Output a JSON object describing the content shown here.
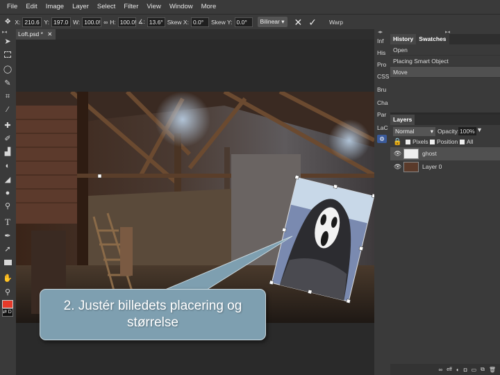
{
  "menu": [
    "File",
    "Edit",
    "Image",
    "Layer",
    "Select",
    "Filter",
    "View",
    "Window",
    "More"
  ],
  "options": {
    "x_label": "X:",
    "x_value": "210.6",
    "y_label": "Y:",
    "y_value": "197.0",
    "w_label": "W:",
    "w_value": "100.0!",
    "link_label": "∞",
    "h_label": "H:",
    "h_value": "100.0!",
    "angle_label": "∡:",
    "angle_value": "13.6°",
    "skewx_label": "Skew X:",
    "skewx_value": "0.0°",
    "skewy_label": "Skew Y:",
    "skewy_value": "0.0°",
    "interp": "Bilinear ▾",
    "cancel_icon": "✕",
    "commit_icon": "✓",
    "warp_label": "Warp"
  },
  "document": {
    "tab_label": "Loft.psd *",
    "close_icon": "✕"
  },
  "mini_panel": [
    "Inf",
    "His",
    "Pro",
    "CSS",
    "Bru",
    "Cha",
    "Par",
    "LaC"
  ],
  "history": {
    "tabs": [
      "History",
      "Swatches"
    ],
    "items": [
      "Open",
      "Placing Smart Object",
      "Move"
    ]
  },
  "layers": {
    "tab": "Layers",
    "blend_mode": "Normal",
    "opacity_label": "Opacity:",
    "opacity_value": "100%",
    "lock_pixels": "Pixels",
    "lock_position": "Position",
    "lock_all": "All",
    "items": [
      {
        "name": "ghost"
      },
      {
        "name": "Layer 0"
      }
    ]
  },
  "colors": {
    "foreground": "#e53a2a",
    "background": "#111111",
    "callout": "#7e9fb0"
  },
  "callout": {
    "line1": "2. Justér billedets placering og",
    "line2": "størrelse"
  }
}
